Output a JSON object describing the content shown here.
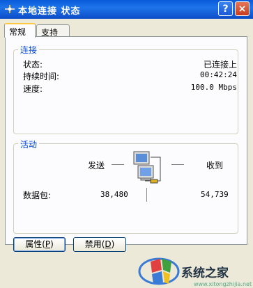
{
  "window": {
    "title": "本地连接 状态",
    "help_glyph": "?",
    "close_glyph": "×"
  },
  "tabs": [
    {
      "label": "常规"
    },
    {
      "label": "支持"
    }
  ],
  "connection": {
    "legend": "连接",
    "status_label": "状态:",
    "status_value": "已连接上",
    "duration_label": "持续时间:",
    "duration_value": "00:42:24",
    "speed_label": "速度:",
    "speed_value": "100.0 Mbps"
  },
  "activity": {
    "legend": "活动",
    "sent_label": "发送",
    "received_label": "收到",
    "packets_label": "数据包:",
    "sent_packets": "38,480",
    "received_packets": "54,739"
  },
  "buttons": {
    "properties_prefix": "属性(",
    "properties_key": "P",
    "properties_suffix": ")",
    "disable_prefix": "禁用(",
    "disable_key": "D",
    "disable_suffix": ")"
  },
  "watermark": {
    "text": "系统之家",
    "url": "www.xitongzhijia.net"
  },
  "colors": {
    "titlebar": "#0a5bd9",
    "legend_text": "#0046d5",
    "tab_highlight": "#ffc73c"
  }
}
